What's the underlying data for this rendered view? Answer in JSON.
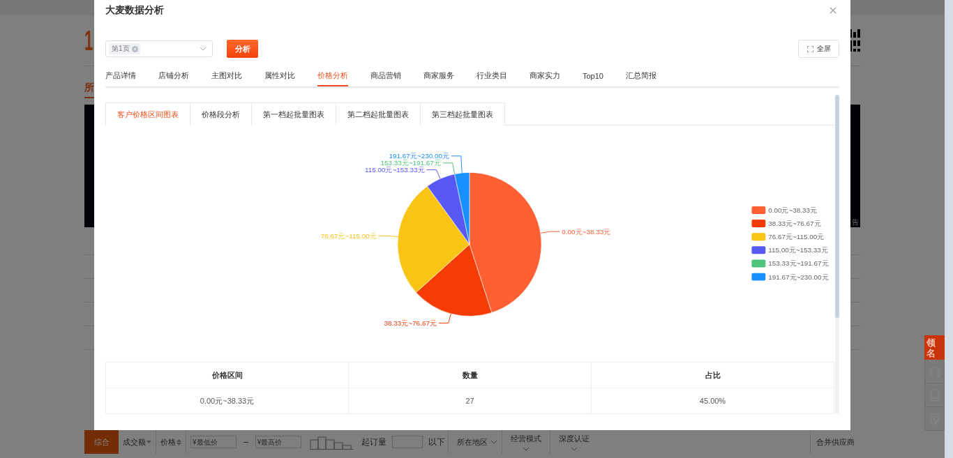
{
  "background_page": {
    "logo": "1",
    "nav_tab": "所",
    "ad_label": "告",
    "side_widget": {
      "label_lines": [
        "领",
        "名"
      ]
    },
    "filter_bar": [
      {
        "kind": "tab",
        "label": "综合",
        "selected": true
      },
      {
        "kind": "sort",
        "label": "成交额"
      },
      {
        "kind": "sort2",
        "label": "价格"
      },
      {
        "kind": "field",
        "placeholder": "¥最低价"
      },
      {
        "kind": "text",
        "label": "–"
      },
      {
        "kind": "field",
        "placeholder": "¥最高价"
      },
      {
        "kind": "histogram"
      },
      {
        "kind": "text",
        "label": "起订量"
      },
      {
        "kind": "blank"
      },
      {
        "kind": "text",
        "label": "以下"
      },
      {
        "kind": "dropdown",
        "label": "所在地区"
      },
      {
        "kind": "dropdown_below",
        "label": "经营模式"
      },
      {
        "kind": "dropdown_below",
        "label": "深度认证"
      },
      {
        "kind": "right",
        "label": "合并供应商"
      }
    ]
  },
  "dialog": {
    "title": "大麦数据分析",
    "page_select": {
      "tags": [
        "第1页"
      ]
    },
    "analyze_button": "分析",
    "fullscreen_button": "全屏",
    "tabs": [
      {
        "label": "产品详情",
        "selected": false
      },
      {
        "label": "店铺分析",
        "selected": false
      },
      {
        "label": "主图对比",
        "selected": false
      },
      {
        "label": "属性对比",
        "selected": false
      },
      {
        "label": "价格分析",
        "selected": true
      },
      {
        "label": "商品营销",
        "selected": false
      },
      {
        "label": "商家服务",
        "selected": false
      },
      {
        "label": "行业类目",
        "selected": false
      },
      {
        "label": "商家实力",
        "selected": false
      },
      {
        "label": "Top10",
        "selected": false
      },
      {
        "label": "汇总简报",
        "selected": false
      }
    ],
    "chart_tabs": [
      {
        "label": "客户价格区间图表",
        "selected": true
      },
      {
        "label": "价格段分析",
        "selected": false
      },
      {
        "label": "第一档起批量图表",
        "selected": false
      },
      {
        "label": "第二档起批量图表",
        "selected": false
      },
      {
        "label": "第三档起批量图表",
        "selected": false
      }
    ],
    "chart_data": {
      "type": "pie",
      "categories": [
        "0.00元~38.33元",
        "38.33元~76.67元",
        "76.67元~115.00元",
        "115.00元~153.33元",
        "153.33元~191.67元",
        "191.67元~230.00元"
      ],
      "values": [
        45,
        18.33,
        26.67,
        6.67,
        0,
        3.33
      ],
      "legend": true,
      "colors": [
        "#ff5f33",
        "#f73b05",
        "#f9c416",
        "#5858f6",
        "#4cc57a",
        "#1890ff"
      ]
    },
    "table": {
      "columns": [
        "价格区间",
        "数量",
        "占比"
      ],
      "rows": [
        [
          "0.00元~38.33元",
          "27",
          "45.00%"
        ]
      ]
    }
  }
}
